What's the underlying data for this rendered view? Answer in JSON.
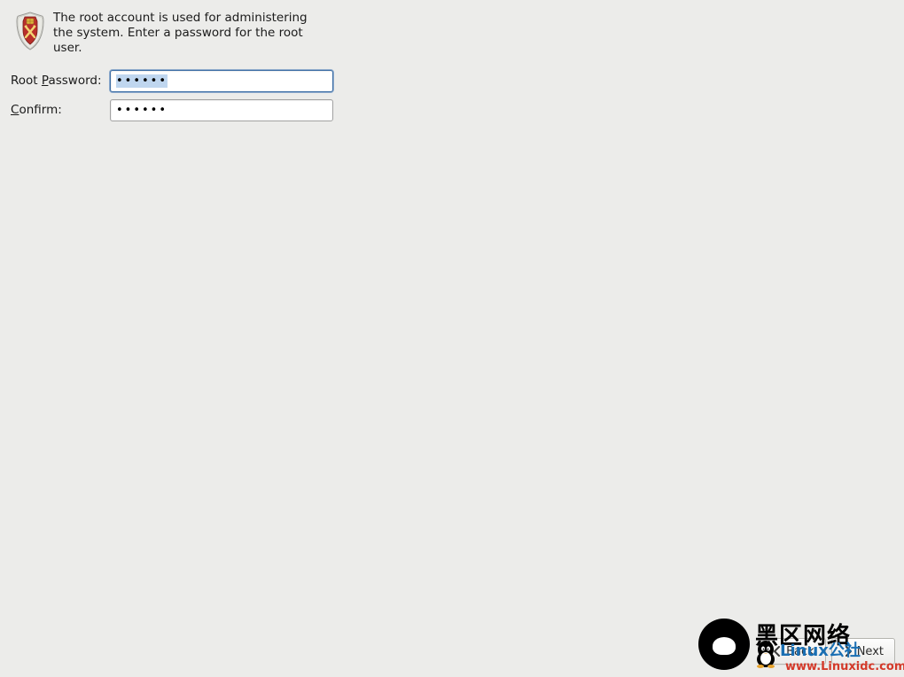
{
  "instruction_text": "The root account is used for administering the system.  Enter a password for the root user.",
  "form": {
    "root_password_label_pre": "Root ",
    "root_password_label_key": "P",
    "root_password_label_post": "assword:",
    "root_password_value": "••••••",
    "confirm_label_key": "C",
    "confirm_label_post": "onfirm:",
    "confirm_value": "••••••"
  },
  "footer": {
    "back_label": "Back",
    "next_label": "Next"
  },
  "watermark": {
    "cn1": "黑区网络",
    "cn2": "Linux公社",
    "url": "www.Linuxidc.com"
  }
}
